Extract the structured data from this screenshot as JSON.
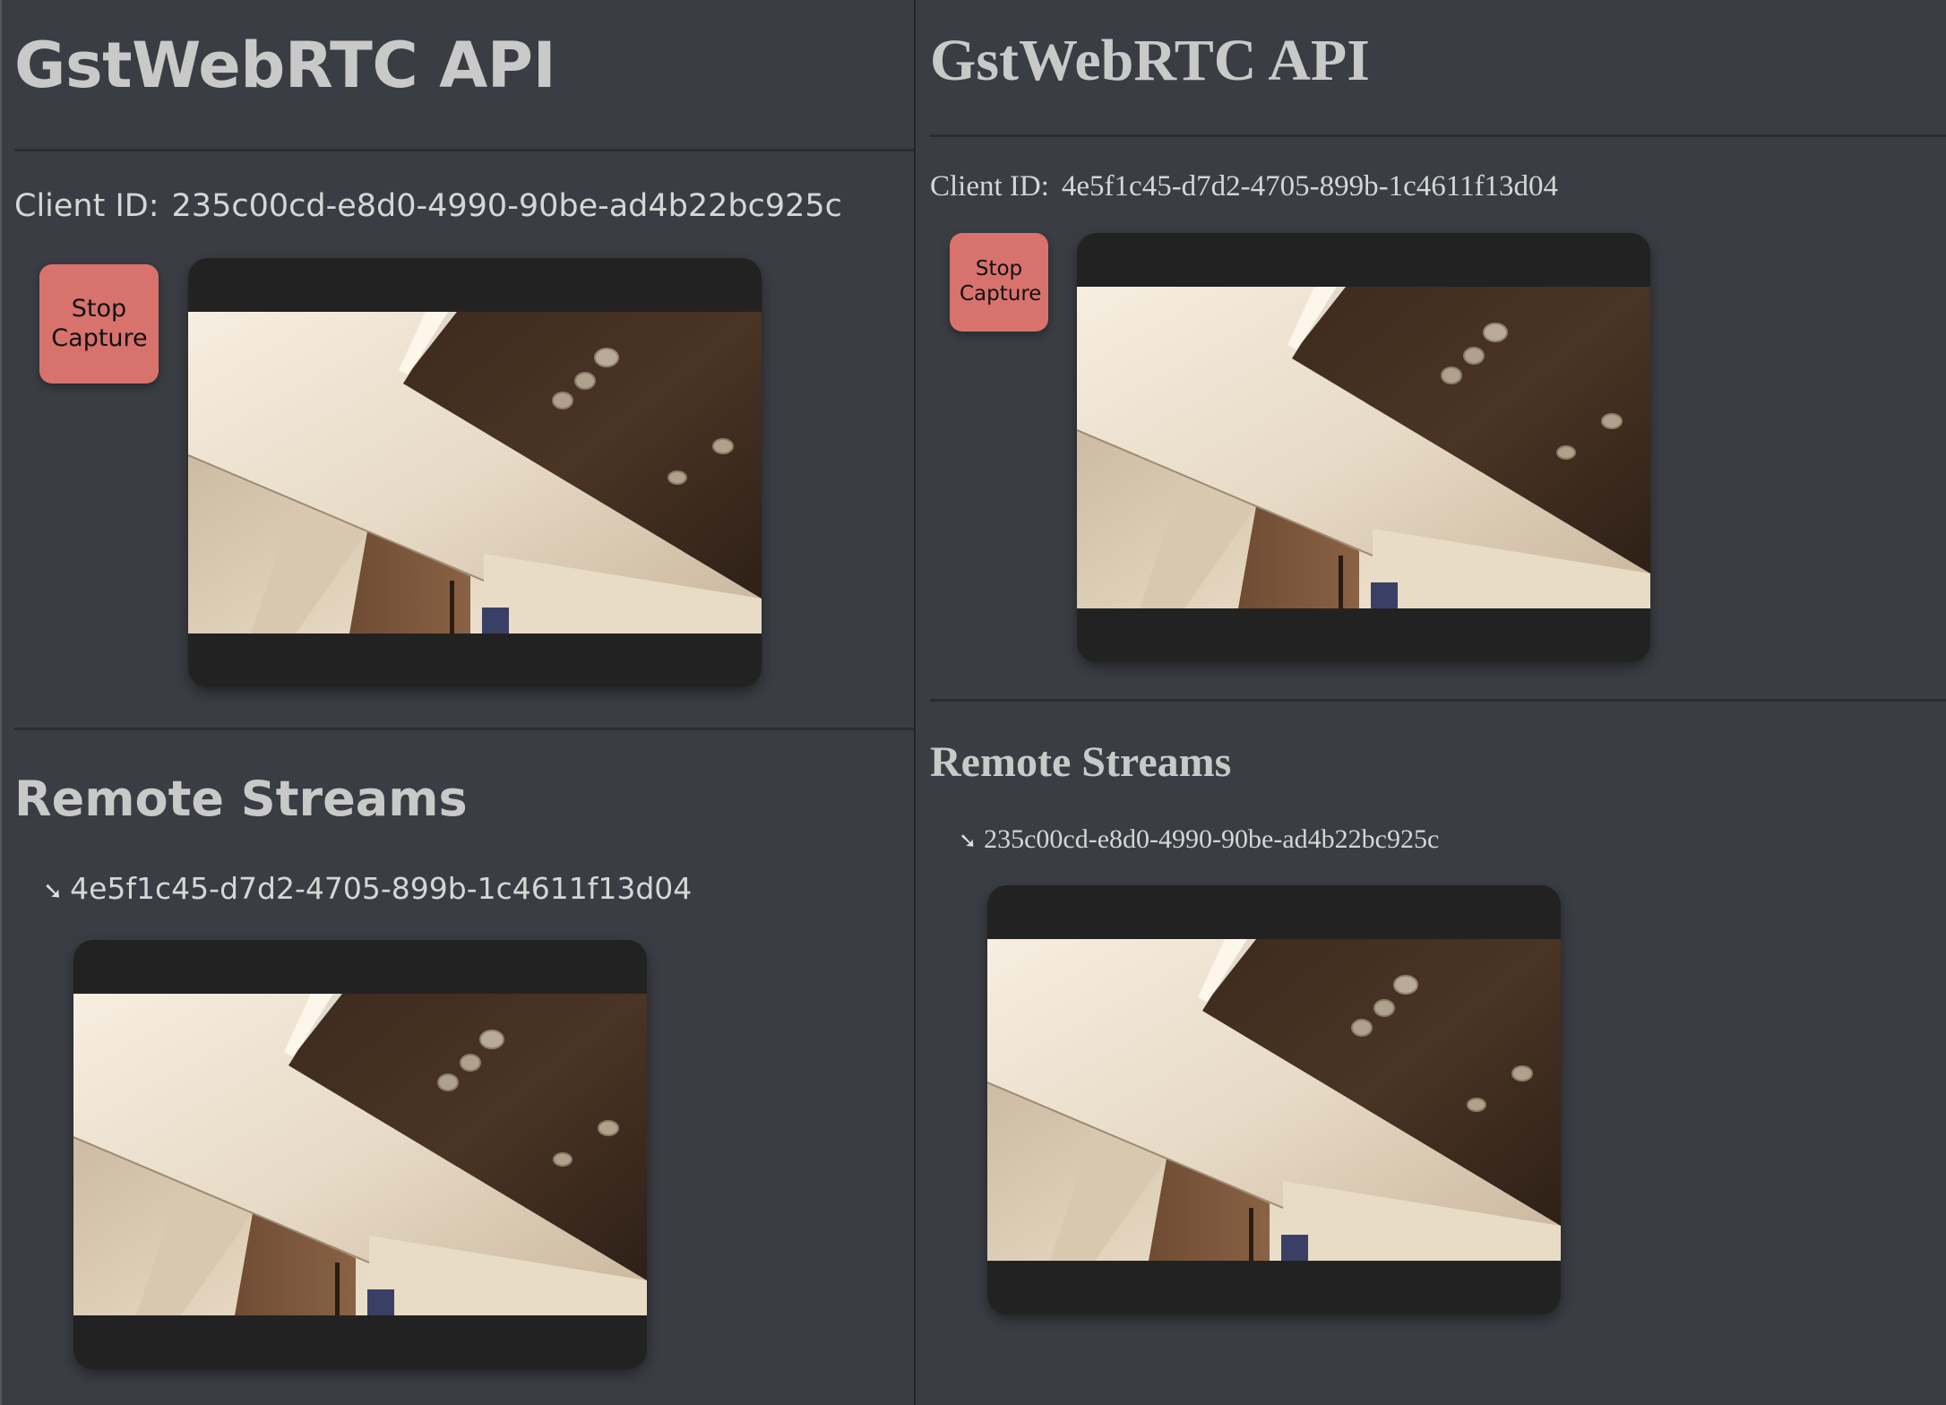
{
  "panes": [
    {
      "title": "GstWebRTC API",
      "client_label": "Client ID:",
      "client_id": "235c00cd-e8d0-4990-90be-ad4b22bc925c",
      "stop_button_label": "Stop Capture",
      "remote_heading": "Remote Streams",
      "remote_peer_id": "4e5f1c45-d7d2-4705-899b-1c4611f13d04"
    },
    {
      "title": "GstWebRTC API",
      "client_label": "Client ID:",
      "client_id": "4e5f1c45-d7d2-4705-899b-1c4611f13d04",
      "stop_button_label": "Stop Capture",
      "remote_heading": "Remote Streams",
      "remote_peer_id": "235c00cd-e8d0-4990-90be-ad4b22bc925c"
    }
  ],
  "icons": {
    "peer_arrow": "arrow-down-right-icon"
  },
  "colors": {
    "background": "#3a3d43",
    "stop_button": "#d8726d",
    "video_letterbox": "#222222",
    "text": "#d2d2d2"
  }
}
